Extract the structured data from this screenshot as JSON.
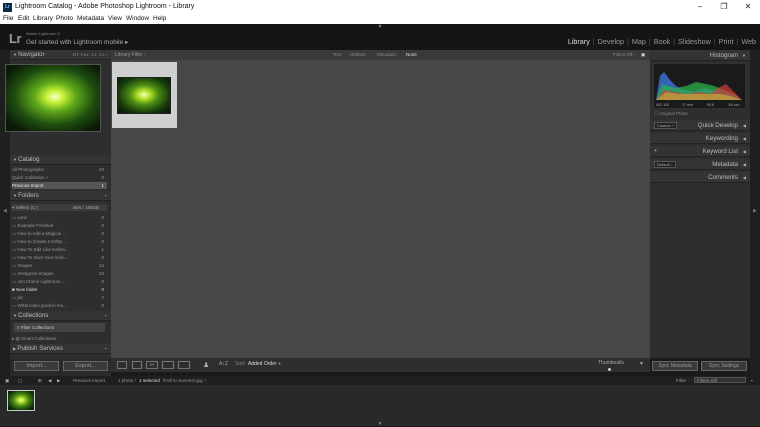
{
  "window": {
    "title": "Lightroom Catalog - Adobe Photoshop Lightroom - Library",
    "minimize": "–",
    "maximize": "❐",
    "close": "✕",
    "logo": "Lr"
  },
  "menu": [
    "File",
    "Edit",
    "Library",
    "Photo",
    "Metadata",
    "View",
    "Window",
    "Help"
  ],
  "identity": {
    "logo": "Lr",
    "app_label": "Adobe Lightroom 5",
    "get_started": "Get started with Lightroom mobile ▸"
  },
  "modules": [
    "Library",
    "Develop",
    "Map",
    "Book",
    "Slideshow",
    "Print",
    "Web"
  ],
  "navigator": {
    "title": "Navigator",
    "zoom": [
      "FIT",
      "FILL",
      "1:1",
      "3:1 ÷"
    ]
  },
  "catalog": {
    "title": "Catalog",
    "items": [
      {
        "label": "All Photographs",
        "count": "40"
      },
      {
        "label": "Quick Collection +",
        "count": "0"
      },
      {
        "label": "Previous Import",
        "count": "1"
      }
    ]
  },
  "folders": {
    "title": "Folders",
    "volume": "Seflest (C:)",
    "volume_info": "46/6 / 165GB",
    "items": [
      {
        "label": "Lenz",
        "count": "0"
      },
      {
        "label": "Example Finished",
        "count": "0"
      },
      {
        "label": "How to Add a Magical ...",
        "count": "0"
      },
      {
        "label": "How to Create a Gritty ...",
        "count": "0"
      },
      {
        "label": "How To Edit Like Kalina...",
        "count": "1"
      },
      {
        "label": "How To Give Your Archi...",
        "count": "0"
      },
      {
        "label": "Images",
        "count": "12"
      },
      {
        "label": "Instagram Images",
        "count": "23"
      },
      {
        "label": "Jon Cherin Lightroom ...",
        "count": "0"
      },
      {
        "label": "New folder",
        "count": "0"
      },
      {
        "label": "pic",
        "count": "2"
      },
      {
        "label": "What looks good in Ins...",
        "count": "0"
      }
    ]
  },
  "collections": {
    "title": "Collections",
    "filter": "Filter Collections",
    "smart": "Smart Collections"
  },
  "publish": {
    "title": "Publish Services"
  },
  "import_btn": "Import...",
  "export_btn": "Export...",
  "filter_bar": {
    "label": "Library Filter :",
    "options": [
      "Text",
      "Attribute",
      "Metadata",
      "None"
    ],
    "active": "None",
    "custom": "Filters Off ÷"
  },
  "toolbar": {
    "sort_label": "Sort:",
    "sort_value": "Added Order ÷",
    "thumbnails": "Thumbnails",
    "az": "A↕Z"
  },
  "histogram": {
    "title": "Histogram",
    "readouts": [
      "ISO 100",
      "17 mm",
      "f/5.6",
      "1/8 sec"
    ],
    "original": "Original Photo"
  },
  "right_panels": {
    "saved_preset": "Custom ÷",
    "quick_develop": "Quick Develop",
    "keywording": "Keywording",
    "keyword_list": "Keyword List",
    "default": "Default ÷",
    "metadata": "Metadata",
    "comments": "Comments"
  },
  "sync_metadata": "Sync Metadata",
  "sync_settings": "Sync Settings",
  "filmstrip": {
    "source": "Previous Import",
    "info": "1 photo /",
    "selected": "1 selected",
    "file": "/Fall to Summer.jpg ÷",
    "filter_label": "Filter :",
    "filter_value": "Filters Off"
  },
  "colors": {
    "accent": "#dddddd",
    "panel": "#2e2e2e",
    "grid": "#474747"
  }
}
